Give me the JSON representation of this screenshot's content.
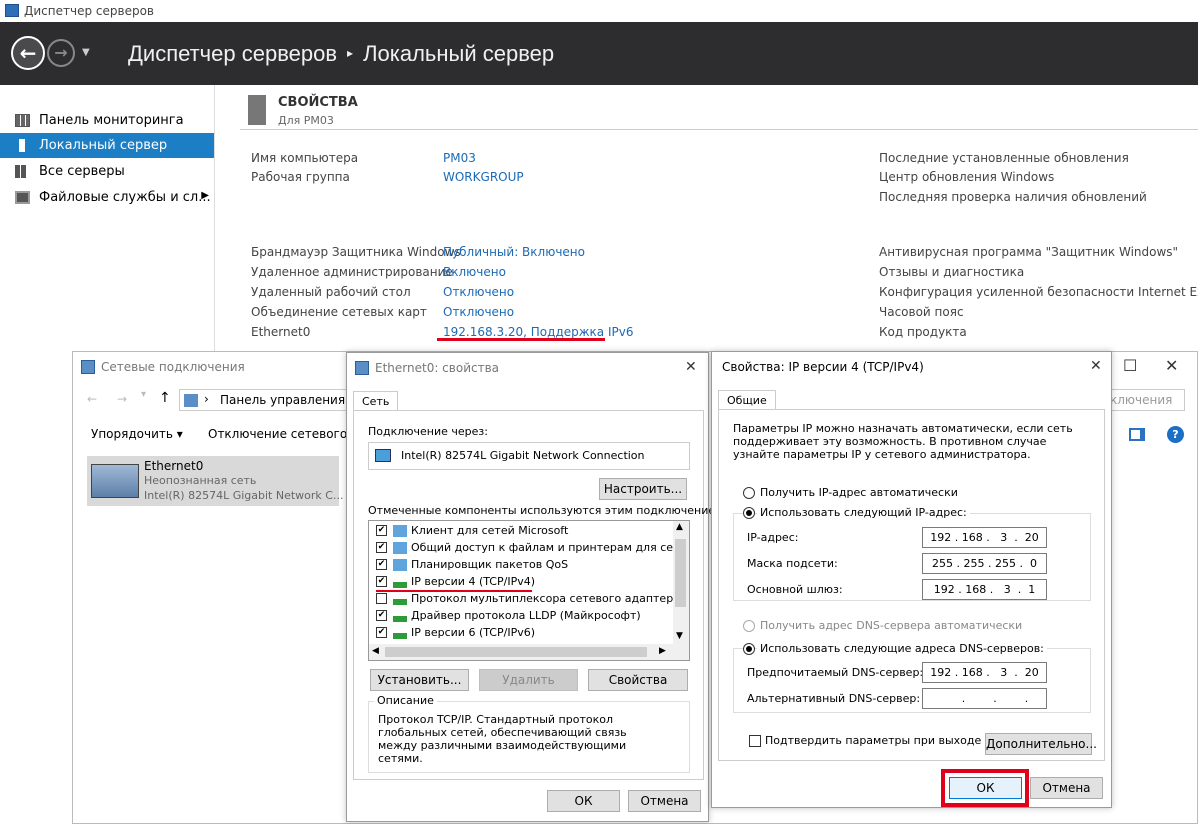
{
  "server_manager": {
    "window_title": "Диспетчер серверов",
    "breadcrumb_root": "Диспетчер серверов",
    "breadcrumb_sep": "▸",
    "breadcrumb_current": "Локальный сервер",
    "sidebar": [
      {
        "label": "Панель мониторинга",
        "icon": "dashboard-icon"
      },
      {
        "label": "Локальный сервер",
        "icon": "server-icon",
        "active": true
      },
      {
        "label": "Все серверы",
        "icon": "servers-icon"
      },
      {
        "label": "Файловые службы и сл...",
        "icon": "file-services-icon"
      }
    ],
    "properties": {
      "title": "СВОЙСТВА",
      "subtitle": "Для PM03",
      "left_labels": [
        "Имя компьютера",
        "Рабочая группа"
      ],
      "left_values": [
        "PM03",
        "WORKGROUP"
      ],
      "mid_labels": [
        "Брандмауэр Защитника Windows",
        "Удаленное администрирование",
        "Удаленный рабочий стол",
        "Объединение сетевых карт",
        "Ethernet0"
      ],
      "mid_values": [
        "Публичный: Включено",
        "Включено",
        "Отключено",
        "Отключено",
        "192.168.3.20, Поддержка IPv6"
      ],
      "right_top": [
        "Последние установленные обновления",
        "Центр обновления Windows",
        "Последняя проверка наличия обновлений"
      ],
      "right_bottom": [
        "Антивирусная программа \"Защитник Windows\"",
        "Отзывы и диагностика",
        "Конфигурация усиленной безопасности Internet Explorer",
        "Часовой пояс",
        "Код продукта"
      ]
    }
  },
  "net_connections": {
    "title": "Сетевые подключения",
    "address_path": "Панель управления",
    "search_hint": "ключения",
    "toolbar": [
      "Упорядочить ▾",
      "Отключение сетевого уст"
    ],
    "item": {
      "name": "Ethernet0",
      "status": "Неопознанная сеть",
      "adapter": "Intel(R) 82574L Gigabit Network C..."
    }
  },
  "eth_props": {
    "title": "Ethernet0: свойства",
    "tab": "Сеть",
    "connect_via_label": "Подключение через:",
    "adapter": "Intel(R) 82574L Gigabit Network Connection",
    "configure_btn": "Настроить...",
    "components_label": "Отмеченные компоненты используются этим подключением:",
    "components": [
      {
        "label": "Клиент для сетей Microsoft",
        "checked": true
      },
      {
        "label": "Общий доступ к файлам и принтерам для сетей Mi",
        "checked": true
      },
      {
        "label": "Планировщик пакетов QoS",
        "checked": true
      },
      {
        "label": "IP версии 4 (TCP/IPv4)",
        "checked": true
      },
      {
        "label": "Протокол мультиплексора сетевого адаптера (Ma",
        "checked": false
      },
      {
        "label": "Драйвер протокола LLDP (Майкрософт)",
        "checked": true
      },
      {
        "label": "IP версии 6 (TCP/IPv6)",
        "checked": true
      }
    ],
    "install_btn": "Установить...",
    "remove_btn": "Удалить",
    "properties_btn": "Свойства",
    "description_label": "Описание",
    "description": "Протокол TCP/IP. Стандартный протокол глобальных сетей, обеспечивающий связь между различными взаимодействующими сетями.",
    "ok": "ОК",
    "cancel": "Отмена"
  },
  "ipv4": {
    "title": "Свойства: IP версии 4 (TCP/IPv4)",
    "tab": "Общие",
    "intro": "Параметры IP можно назначать автоматически, если сеть поддерживает эту возможность. В противном случае узнайте параметры IP у сетевого администратора.",
    "auto_ip": "Получить IP-адрес автоматически",
    "manual_ip": "Использовать следующий IP-адрес:",
    "ip_label": "IP-адрес:",
    "ip_value": "192 . 168 .   3  .  20",
    "mask_label": "Маска подсети:",
    "mask_value": "255 . 255 . 255 .  0",
    "gw_label": "Основной шлюз:",
    "gw_value": "192 . 168 .   3  .  1",
    "auto_dns": "Получить адрес DNS-сервера автоматически",
    "manual_dns": "Использовать следующие адреса DNS-серверов:",
    "pref_dns_label": "Предпочитаемый DNS-сервер:",
    "pref_dns_value": "192 . 168 .   3  .  20",
    "alt_dns_label": "Альтернативный DNS-сервер:",
    "alt_dns_value": "      .        .        .",
    "validate": "Подтвердить параметры при выходе",
    "advanced_btn": "Дополнительно...",
    "ok": "ОК",
    "cancel": "Отмена"
  },
  "colors": {
    "accent": "#1c7ec4",
    "link": "#1b6ab5",
    "highlight_red": "#e0001b"
  }
}
